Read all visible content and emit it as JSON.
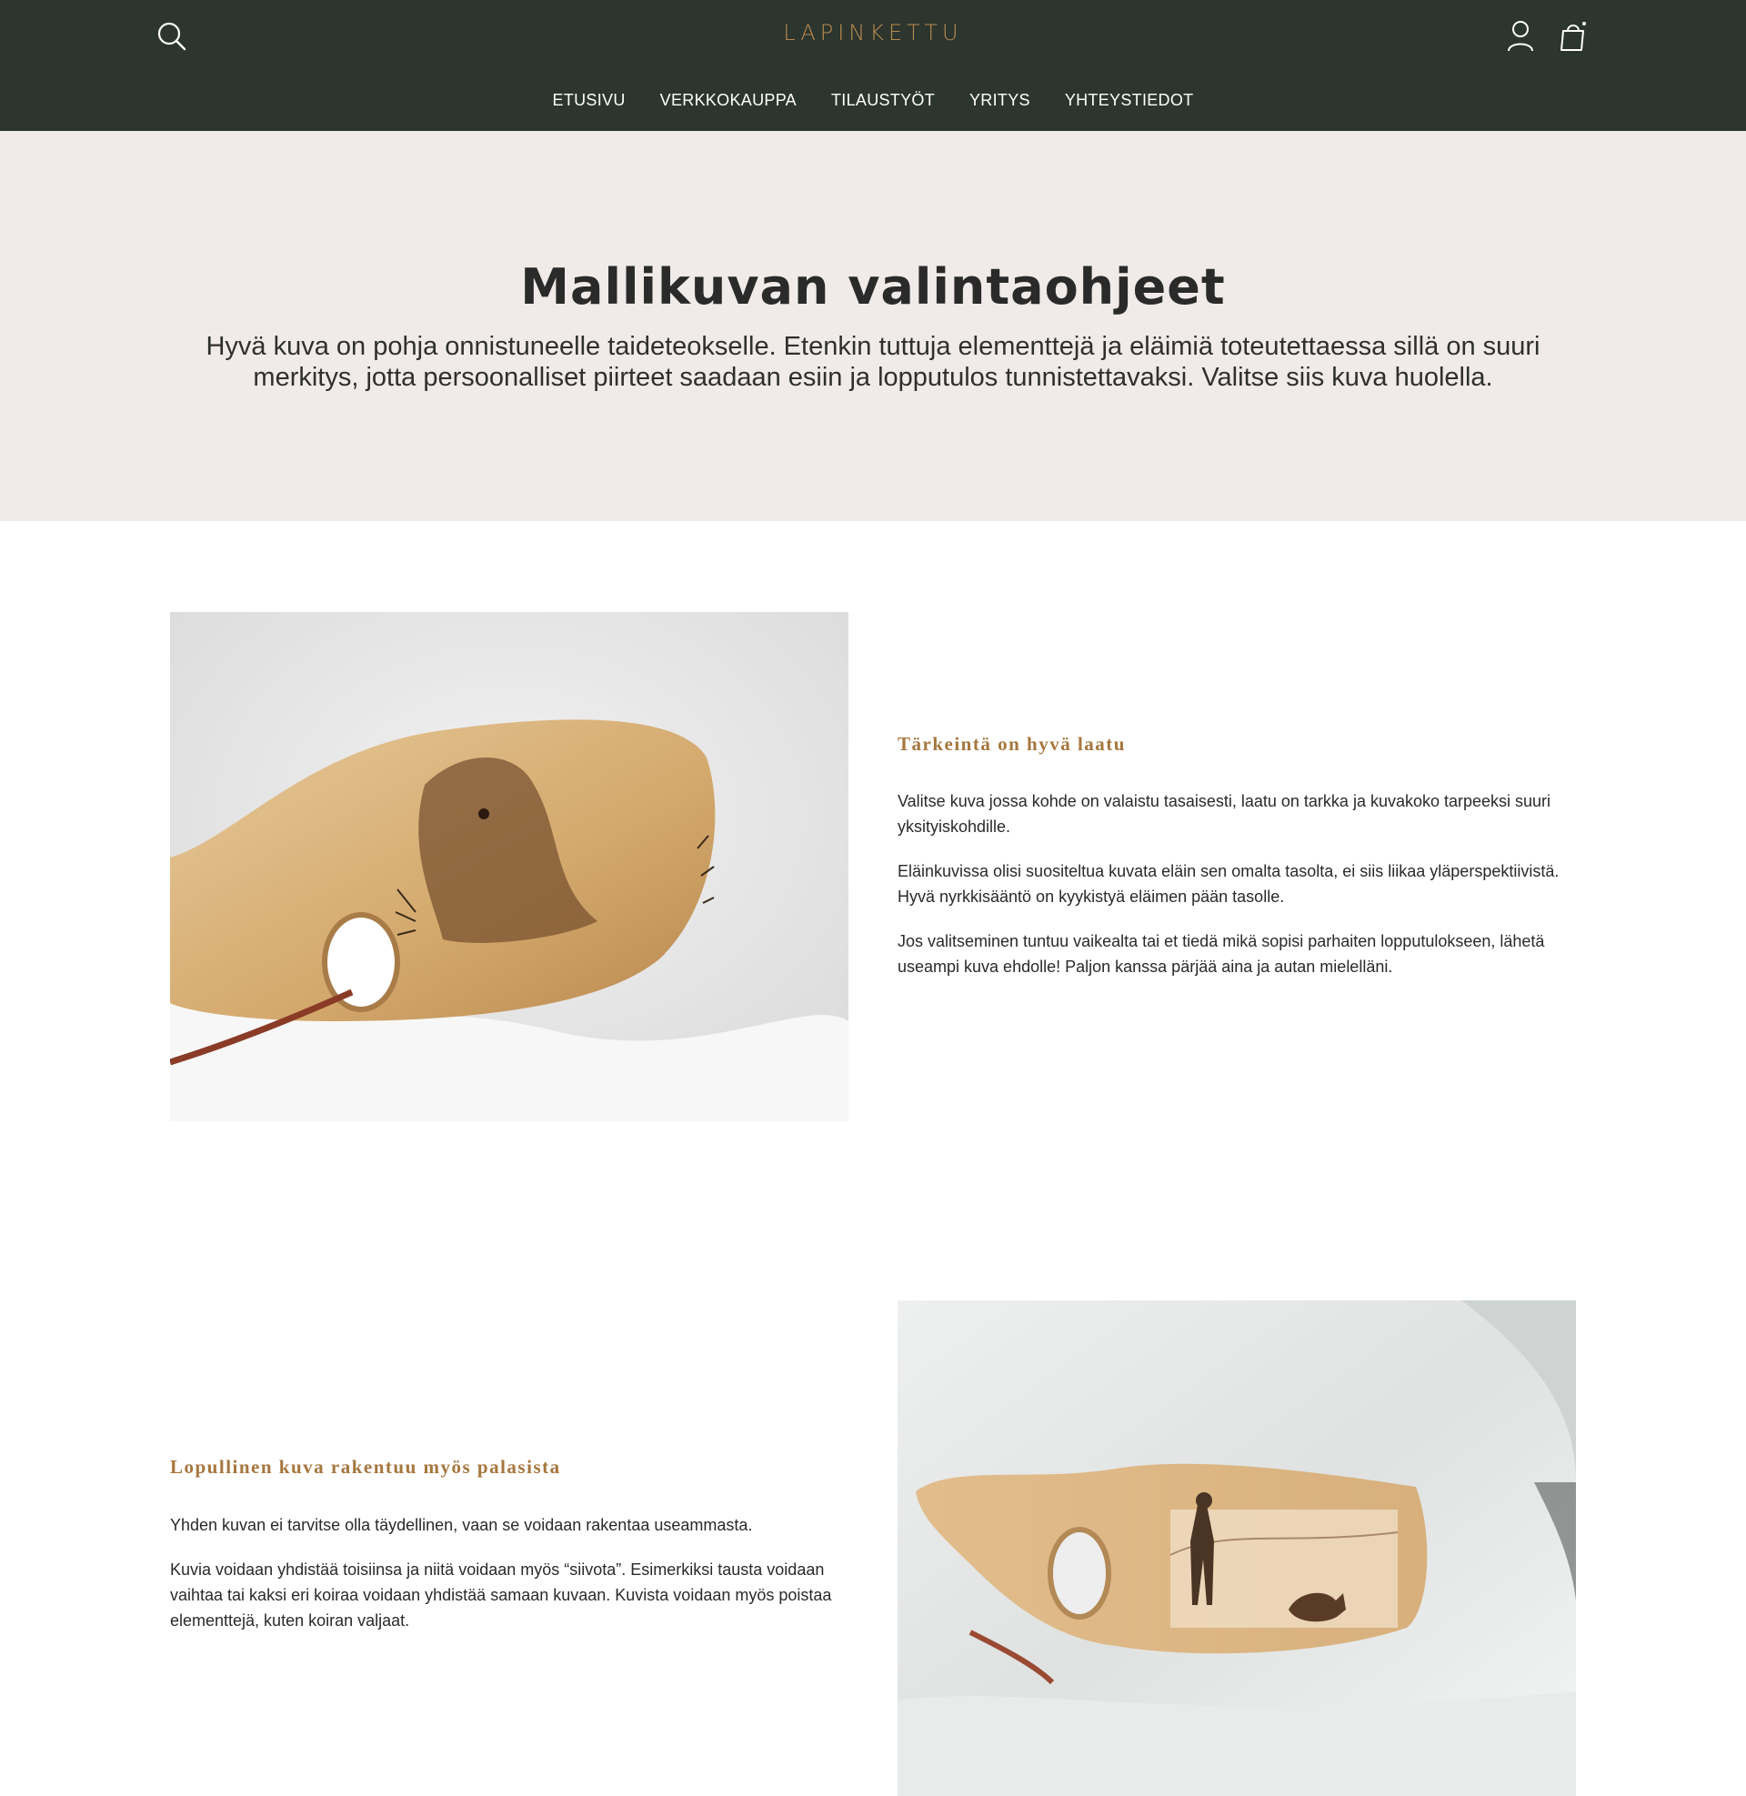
{
  "header": {
    "logo": "LAPINKETTU",
    "nav": [
      "ETUSIVU",
      "VERKKOKAUPPA",
      "TILAUSTYÖT",
      "YRITYS",
      "YHTEYSTIEDOT"
    ],
    "icons": {
      "search": "search-icon",
      "account": "user-icon",
      "cart": "shopping-bag-icon"
    },
    "colors": {
      "background": "#2c352e",
      "logo": "#b98a4e",
      "nav_text": "#ffffff"
    }
  },
  "hero": {
    "title": "Mallikuvan valintaohjeet",
    "text": "Hyvä kuva on pohja onnistuneelle taideteokselle. Etenkin tuttuja elementtejä ja eläimiä toteutettaessa sillä on suuri merkitys, jotta persoonalliset piirteet saadaan esiin ja lopputulos tunnistettavaksi. Valitse siis kuva huolella.",
    "background": "#f0ebe8"
  },
  "sections": [
    {
      "title": "Tärkeintä on hyvä laatu",
      "paragraphs": [
        "Valitse kuva jossa kohde on valaistu tasaisesti, laatu on tarkka ja kuvakoko tarpeeksi suuri yksityiskohdille.",
        "Eläinkuvissa olisi suositeltua kuvata eläin sen omalta tasolta, ei siis liikaa yläperspektiivistä. Hyvä nyrkkisääntö on kyykistyä eläimen pään tasolle.",
        "Jos valitseminen tuntuu vaikealta tai et tiedä mikä sopisi parhaiten lopputulokseen, lähetä useampi kuva ehdolle! Paljon kanssa pärjää aina ja autan mielelläni."
      ]
    },
    {
      "title": "Lopullinen kuva rakentuu myös palasista",
      "paragraphs": [
        "Yhden kuvan ei tarvitse olla täydellinen, vaan se voidaan rakentaa useammasta.",
        "Kuvia voidaan yhdistää toisiinsa ja niitä voidaan myös “siivota”. Esimerkiksi tausta voidaan vaihtaa tai kaksi eri koiraa voidaan yhdistää samaan kuvaan. Kuvista voidaan myös poistaa elementtejä, kuten koiran valjaat."
      ]
    }
  ],
  "accent_color": "#a6763e"
}
